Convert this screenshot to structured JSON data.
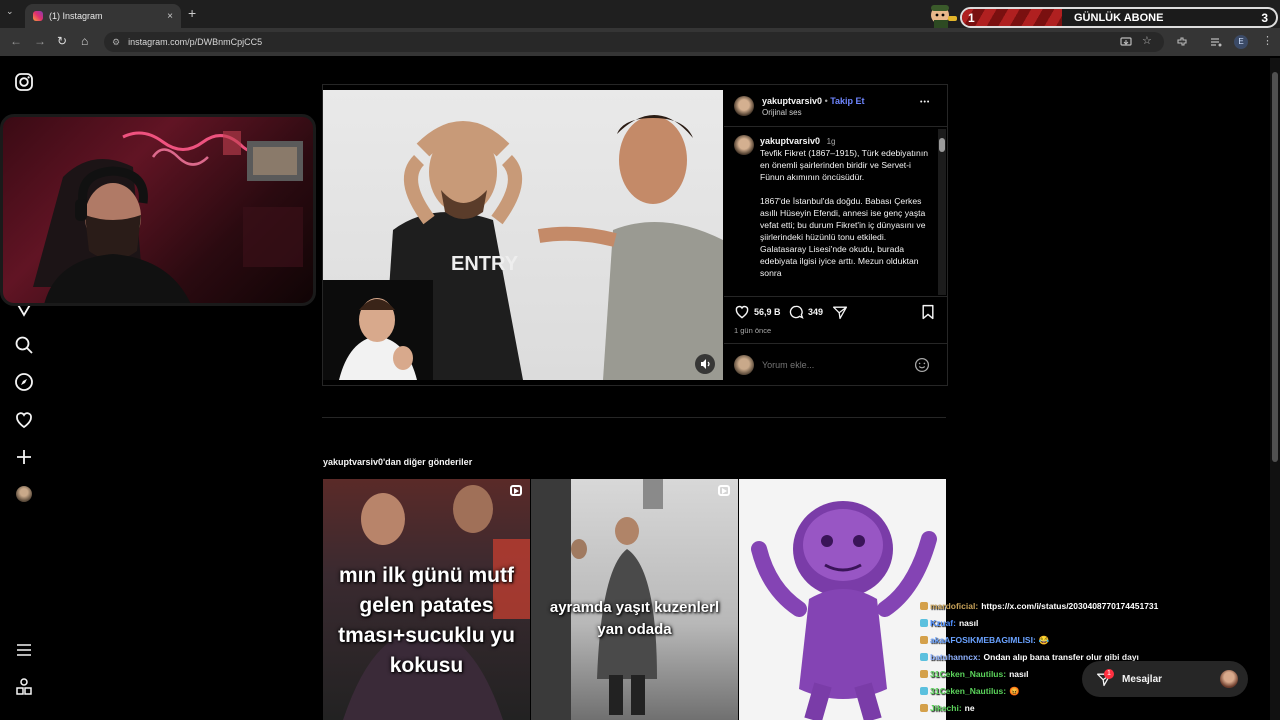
{
  "browser": {
    "tab_title": "(1) Instagram",
    "tab_close": "×",
    "new_tab": "+",
    "tab_menu": "⌄",
    "url": "instagram.com/p/DWBnmCpjCC5",
    "back": "←",
    "forward": "→",
    "reload": "↻",
    "home": "⌂"
  },
  "overlay": {
    "subscriber_rank": "1",
    "subscriber_label": "GÜNLÜK ABONE",
    "subscriber_count": "3"
  },
  "post": {
    "username": "yakuptvarsiv0",
    "follow_label": "Takip Et",
    "audio_label": "Orijinal ses",
    "more_label": "•••",
    "caption_username": "yakuptvarsiv0",
    "caption_age": "1g",
    "caption": "Tevfik Fikret (1867–1915), Türk edebiyatının en önemli şairlerinden biridir ve Servet-i Fünun akımının öncüsüdür.\n\n1867'de İstanbul'da doğdu. Babası Çerkes asıllı Hüseyin Efendi, annesi ise genç yaşta vefat etti; bu durum Fikret'in iç dünyasını ve şiirlerindeki hüzünlü tonu etkiledi. Galatasaray Lisesi'nde okudu, burada edebiyata ilgisi iyice arttı. Mezun olduktan sonra",
    "likes": "56,9 B",
    "comments": "349",
    "posted_ago": "1 gün önce",
    "comment_placeholder": "Yorum ekle...",
    "video_shirt_text": "ENTRY"
  },
  "more_posts": {
    "label": "yakuptvarsiv0'dan diğer gönderiler",
    "items": [
      {
        "text_lines": [
          "mın ilk günü mutf",
          "gelen patates",
          "tması+sucuklu yu",
          "kokusu"
        ]
      },
      {
        "text_lines": [
          "ayramda yaşıt kuzenlerl",
          "yan odada"
        ]
      },
      {
        "text_lines": []
      }
    ]
  },
  "chat": [
    {
      "user": "mardoficial:",
      "message": "https://x.com/i/status/2030408770174451731",
      "color": "#c9a35a"
    },
    {
      "user": "Kzuaf:",
      "message": "nasıl",
      "color": "#4f8fff"
    },
    {
      "user": "akaAFOSIKMEBAGIMLISI:",
      "message": "😂",
      "color": "#6aa2ff"
    },
    {
      "user": "batuhanncx:",
      "message": "Ondan alıp bana transfer olur gibi dayı",
      "color": "#8fb2ff"
    },
    {
      "user": "31Ceken_Nautilus:",
      "message": "nasıl",
      "color": "#5bd35b"
    },
    {
      "user": "31Ceken_Nautilus:",
      "message": "😡",
      "color": "#5bd35b"
    },
    {
      "user": "Jikechi:",
      "message": "ne",
      "color": "#5bd35b"
    }
  ],
  "messages": {
    "label": "Mesajlar",
    "count": "1"
  },
  "colors": {
    "follow_blue": "#0095f6",
    "instagram_bg": "#000000",
    "notification_red": "#ff3040"
  },
  "icons": {
    "left_nav": [
      "instagram-logo-icon",
      "reels-icon",
      "search-icon",
      "explore-icon",
      "heart-icon",
      "create-icon",
      "profile-avatar",
      "menu-icon",
      "apps-icon"
    ]
  }
}
